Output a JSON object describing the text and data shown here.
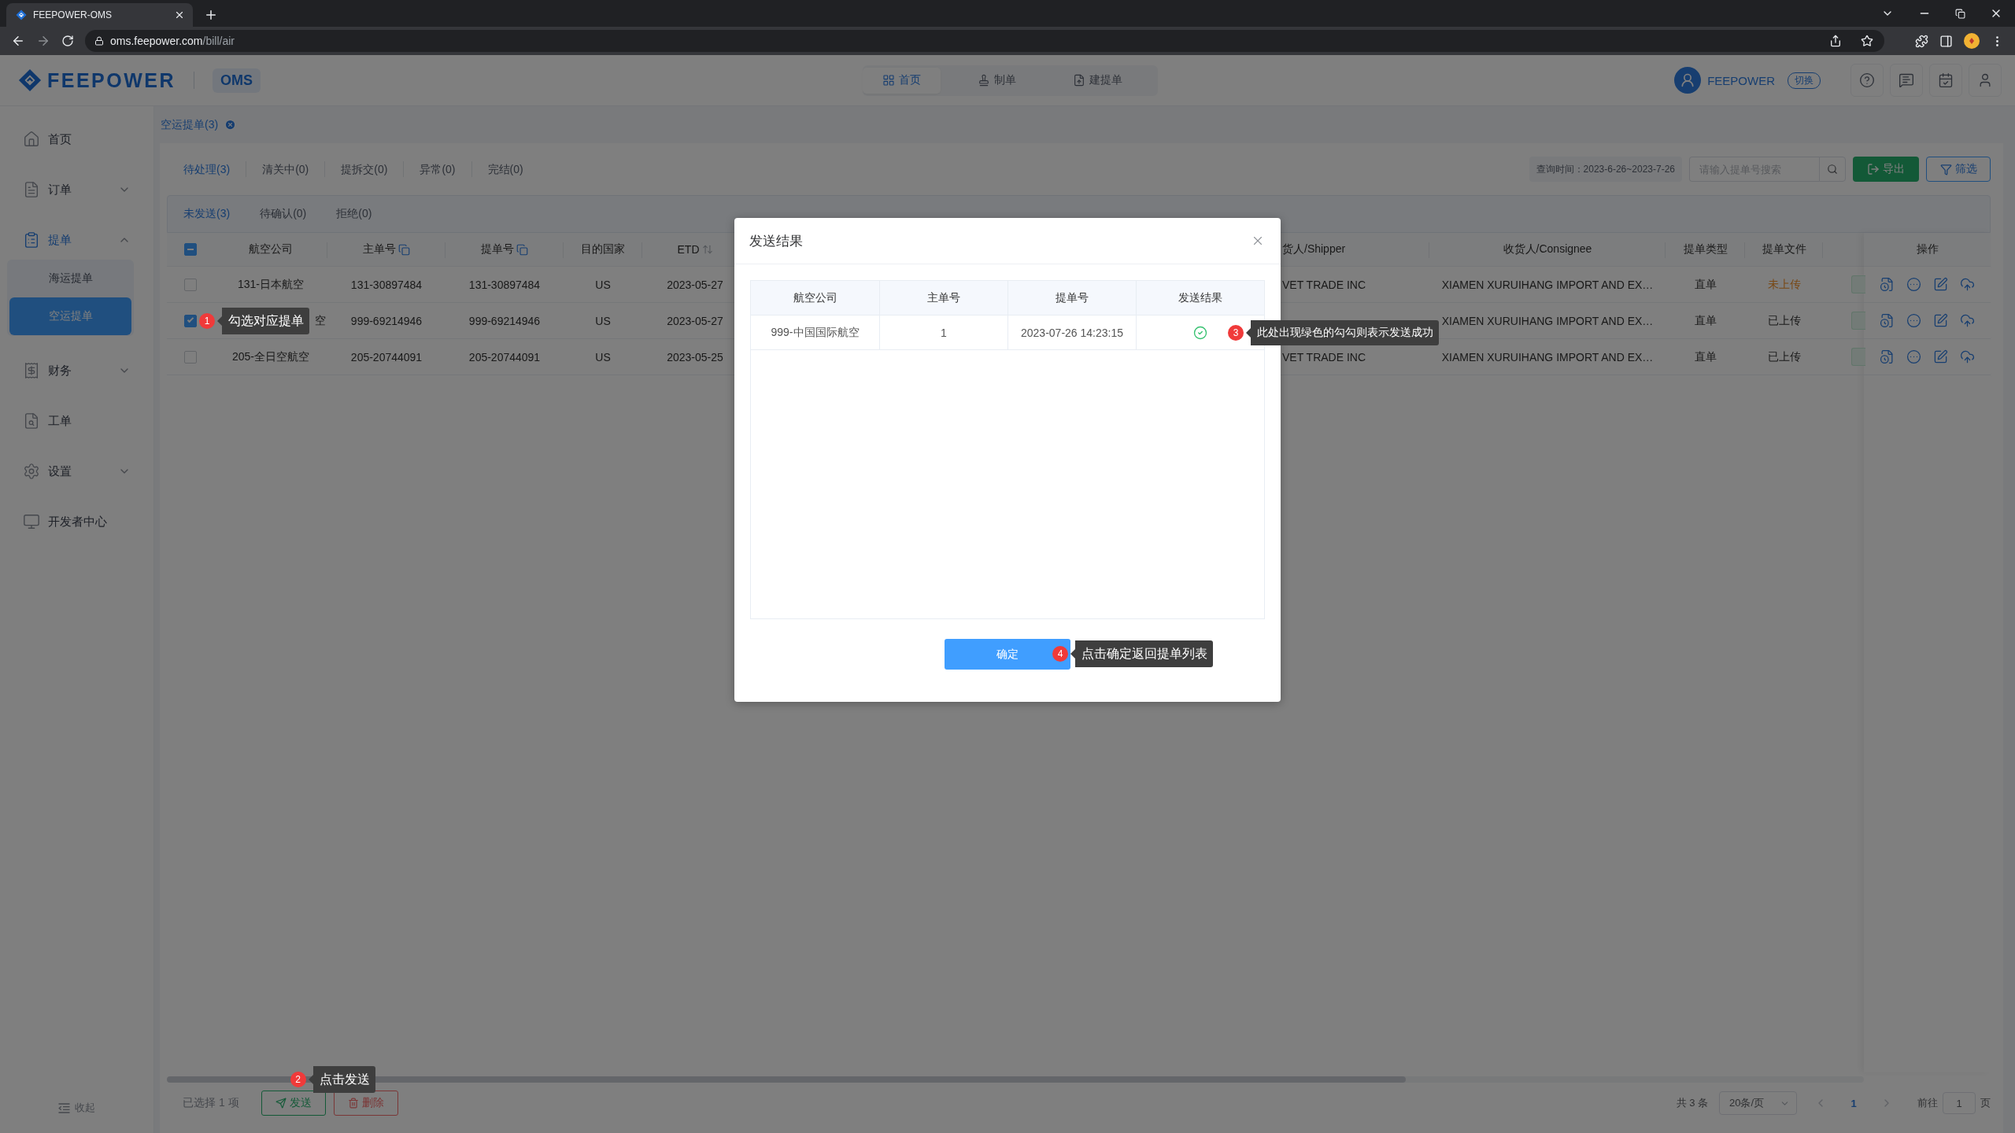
{
  "browser": {
    "tab_title": "FEEPOWER-OMS",
    "url_host": "oms.feepower.com",
    "url_path": "/bill/air"
  },
  "header": {
    "logo_text": "FEEPOWER",
    "app_name": "OMS",
    "nav": [
      {
        "label": "首页",
        "selected": true
      },
      {
        "label": "制单",
        "selected": false
      },
      {
        "label": "建提单",
        "selected": false
      }
    ],
    "user_name": "FEEPOWER",
    "switch_label": "切换"
  },
  "sidebar": {
    "items": [
      {
        "label": "首页",
        "selected": false
      },
      {
        "label": "订单",
        "selected": false,
        "expanded": false
      },
      {
        "label": "提单",
        "selected": true,
        "expanded": true,
        "children": [
          {
            "label": "海运提单",
            "selected": false
          },
          {
            "label": "空运提单",
            "selected": true
          }
        ]
      },
      {
        "label": "财务",
        "selected": false,
        "expanded": false
      },
      {
        "label": "工单",
        "selected": false
      },
      {
        "label": "设置",
        "selected": false,
        "expanded": false
      },
      {
        "label": "开发者中心",
        "selected": false
      }
    ],
    "collapse_label": "收起"
  },
  "page_tabs": [
    {
      "label": "空运提单(3)",
      "selected": true
    }
  ],
  "status_tabs": [
    {
      "label": "待处理(3)",
      "selected": true
    },
    {
      "label": "清关中(0)",
      "selected": false
    },
    {
      "label": "提拆交(0)",
      "selected": false
    },
    {
      "label": "异常(0)",
      "selected": false
    },
    {
      "label": "完结(0)",
      "selected": false
    }
  ],
  "toolbar": {
    "date_range": "查询时间：2023-6-26~2023-7-26",
    "search": {
      "placeholder": "请输入提单号搜索"
    },
    "export_label": "导出",
    "filter_label": "筛选"
  },
  "sub_tabs": [
    {
      "label": "未发送(3)",
      "selected": true
    },
    {
      "label": "待确认(0)",
      "selected": false
    },
    {
      "label": "拒绝(0)",
      "selected": false
    }
  ],
  "table": {
    "select_all_indeterminate": true,
    "columns": [
      {
        "label": "航空公司"
      },
      {
        "label": "主单号",
        "copy_icon": true
      },
      {
        "label": "提单号",
        "copy_icon": true
      },
      {
        "label": "目的国家"
      },
      {
        "label": "ETD",
        "sortable": true
      },
      {
        "label": "货人/Shipper"
      },
      {
        "label": "收货人/Consignee"
      },
      {
        "label": "提单类型"
      },
      {
        "label": "提单文件"
      },
      {
        "label": "操作"
      }
    ],
    "rows": [
      {
        "selected": false,
        "airline": "131-日本航空",
        "master_no": "131-30897484",
        "bill_no": "131-30897484",
        "country": "US",
        "etd": "2023-05-27",
        "shipper": "VET TRADE INC",
        "consignee": "XIAMEN XURUIHANG IMPORT AND EX…",
        "bill_type": "直单",
        "file_status": "未上传",
        "file_uploaded": false
      },
      {
        "selected": true,
        "callout": {
          "number": "1",
          "text": "勾选对应提单"
        },
        "airline": "空",
        "master_no": "999-69214946",
        "bill_no": "999-69214946",
        "country": "US",
        "etd": "2023-05-27",
        "consignee": "XIAMEN XURUIHANG IMPORT AND EX…",
        "bill_type": "直单",
        "file_status": "已上传",
        "file_uploaded": true
      },
      {
        "selected": false,
        "airline": "205-全日空航空",
        "master_no": "205-20744091",
        "bill_no": "205-20744091",
        "country": "US",
        "etd": "2023-05-25",
        "shipper": "VET TRADE INC",
        "consignee": "XIAMEN XURUIHANG IMPORT AND EX…",
        "bill_type": "直单",
        "file_status": "已上传",
        "file_uploaded": true
      }
    ]
  },
  "footer": {
    "selection_text": "已选择 1 项",
    "send_label": "发送",
    "send_callout": {
      "number": "2",
      "text": "点击发送"
    },
    "delete_label": "删除"
  },
  "pagination": {
    "total": "共 3 条",
    "page_size": "20条/页",
    "prev_disabled": true,
    "pages": [
      {
        "label": "1",
        "selected": true
      }
    ],
    "next_disabled": true,
    "goto_label": "前往",
    "goto_value": "1",
    "page_suffix": "页"
  },
  "dialog": {
    "title": "发送结果",
    "columns": [
      "航空公司",
      "主单号",
      "提单号",
      "发送结果"
    ],
    "rows": [
      {
        "airline": "999-中国国际航空",
        "master_no": "1",
        "bill_no": "2023-07-26 14:23:15",
        "sent": true,
        "callout": {
          "number": "3",
          "text": "此处出现绿色的勾勾则表示发送成功"
        }
      }
    ],
    "confirm_label": "确定",
    "confirm_callout": {
      "number": "4",
      "text": "点击确定返回提单列表"
    }
  }
}
